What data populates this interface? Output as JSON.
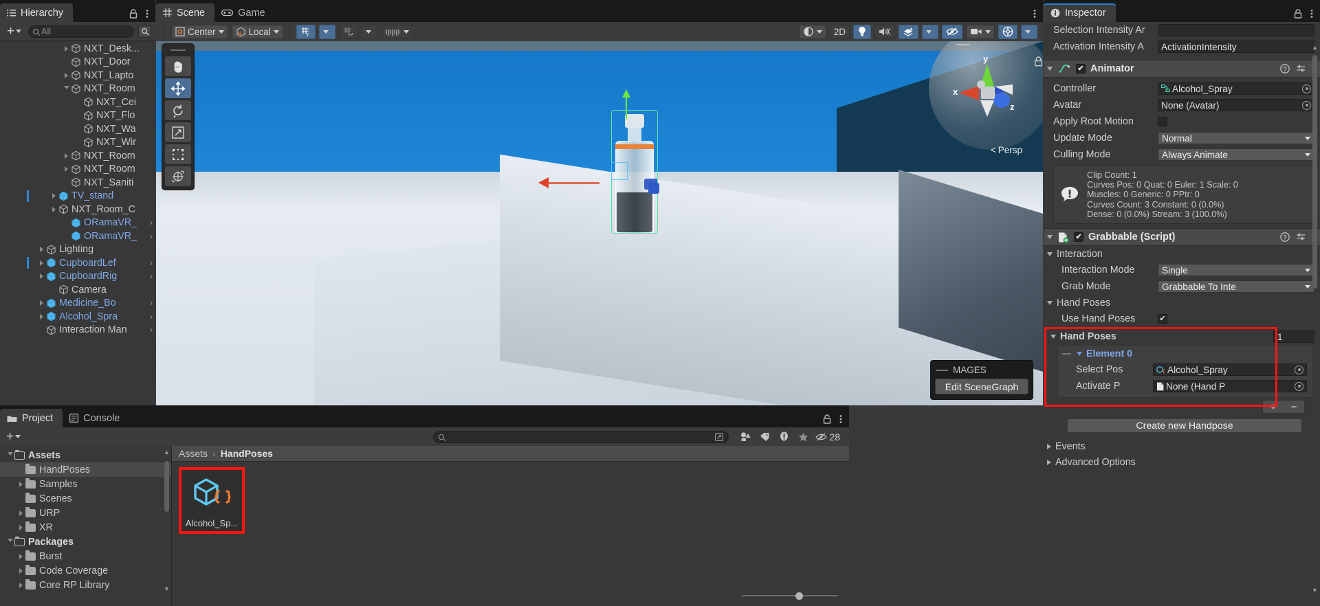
{
  "hierarchy": {
    "tab_label": "Hierarchy",
    "search_placeholder": "All",
    "items": [
      {
        "label": "NXT_Desk...",
        "indent": 4,
        "arrow": "closed",
        "prefab": false,
        "selbar": false
      },
      {
        "label": "NXT_Door",
        "indent": 4,
        "arrow": "none",
        "prefab": false,
        "selbar": false
      },
      {
        "label": "NXT_Lapto",
        "indent": 4,
        "arrow": "closed",
        "prefab": false,
        "selbar": false
      },
      {
        "label": "NXT_Room",
        "indent": 4,
        "arrow": "open",
        "prefab": false,
        "selbar": false
      },
      {
        "label": "NXT_Cei",
        "indent": 5,
        "arrow": "none",
        "prefab": false,
        "selbar": false
      },
      {
        "label": "NXT_Flo",
        "indent": 5,
        "arrow": "none",
        "prefab": false,
        "selbar": false
      },
      {
        "label": "NXT_Wa",
        "indent": 5,
        "arrow": "none",
        "prefab": false,
        "selbar": false
      },
      {
        "label": "NXT_Wir",
        "indent": 5,
        "arrow": "none",
        "prefab": false,
        "selbar": false
      },
      {
        "label": "NXT_Room",
        "indent": 4,
        "arrow": "closed",
        "prefab": false,
        "selbar": false
      },
      {
        "label": "NXT_Room",
        "indent": 4,
        "arrow": "closed",
        "prefab": false,
        "selbar": false
      },
      {
        "label": "NXT_Saniti",
        "indent": 4,
        "arrow": "none",
        "prefab": false,
        "selbar": false
      },
      {
        "label": "TV_stand",
        "indent": 3,
        "arrow": "closed",
        "prefab": true,
        "selbar": true
      },
      {
        "label": "NXT_Room_C",
        "indent": 3,
        "arrow": "closed",
        "prefab": false,
        "selbar": false
      },
      {
        "label": "ORamaVR_",
        "indent": 4,
        "arrow": "none",
        "prefab": true,
        "selbar": false,
        "submenu": true
      },
      {
        "label": "ORamaVR_",
        "indent": 4,
        "arrow": "none",
        "prefab": true,
        "selbar": false,
        "submenu": true
      },
      {
        "label": "Lighting",
        "indent": 2,
        "arrow": "closed",
        "prefab": false,
        "selbar": false
      },
      {
        "label": "CupboardLef",
        "indent": 2,
        "arrow": "closed",
        "prefab": true,
        "selbar": true,
        "submenu": true
      },
      {
        "label": "CupboardRig",
        "indent": 2,
        "arrow": "closed",
        "prefab": true,
        "selbar": false,
        "submenu": true
      },
      {
        "label": "Camera",
        "indent": 3,
        "arrow": "none",
        "prefab": false,
        "selbar": false
      },
      {
        "label": "Medicine_Bo",
        "indent": 2,
        "arrow": "closed",
        "prefab": true,
        "selbar": false,
        "submenu": true
      },
      {
        "label": "Alcohol_Spra",
        "indent": 2,
        "arrow": "closed",
        "prefab": true,
        "selbar": false,
        "submenu": true
      },
      {
        "label": "Interaction Man",
        "indent": 2,
        "arrow": "none",
        "prefab": false,
        "selbar": false,
        "submenu": true
      }
    ]
  },
  "scene": {
    "tabs": [
      {
        "label": "Scene",
        "icon": "grid-icon",
        "active": true
      },
      {
        "label": "Game",
        "icon": "gamepad-icon",
        "active": false
      }
    ],
    "toolbar": {
      "pivot_mode": "Center",
      "handle_space": "Local",
      "grid_snap_icon": "grid-snap-icon",
      "magnet_snap_icon": "magnet-snap-icon",
      "ruler_icon": "ruler-icon",
      "shading_icon": "shading-mode-icon",
      "two_d_label": "2D",
      "light_icon": "lighting-icon",
      "audio_icon": "audio-mute-icon",
      "effects_icon": "effects-icon",
      "hidden_icon": "hidden-objects-icon",
      "camera_icon": "scene-camera-icon",
      "gizmos_icon": "gizmos-icon",
      "options_icon": "kebab-menu-icon"
    },
    "tool_palette": [
      {
        "name": "hand-tool",
        "icon": "✋",
        "active": false
      },
      {
        "name": "move-tool",
        "icon": "move",
        "active": true
      },
      {
        "name": "rotate-tool",
        "icon": "rotate",
        "active": false
      },
      {
        "name": "scale-tool",
        "icon": "scale",
        "active": false
      },
      {
        "name": "rect-tool",
        "icon": "rect",
        "active": false
      },
      {
        "name": "transform-tool",
        "icon": "transform",
        "active": false
      }
    ],
    "gizmo": {
      "x_label": "x",
      "y_label": "y",
      "z_label": "z",
      "perspective_label": "Persp"
    },
    "mages_overlay": {
      "title": "MAGES",
      "button": "Edit SceneGraph"
    }
  },
  "project": {
    "tabs": [
      {
        "label": "Project",
        "icon": "folder-icon",
        "active": true
      },
      {
        "label": "Console",
        "icon": "console-icon",
        "active": false
      }
    ],
    "search_placeholder": "",
    "filter_icons": [
      "asset-type-filter-icon",
      "label-filter-icon",
      "warning-filter-icon",
      "favorites-filter-icon"
    ],
    "hidden_count": "28",
    "tree": [
      {
        "label": "Assets",
        "indent": 0,
        "arrow": "open",
        "bold": true,
        "open_folder": true,
        "selected": false
      },
      {
        "label": "HandPoses",
        "indent": 1,
        "arrow": "none",
        "bold": false,
        "open_folder": false,
        "selected": true
      },
      {
        "label": "Samples",
        "indent": 1,
        "arrow": "closed",
        "bold": false,
        "open_folder": false,
        "selected": false
      },
      {
        "label": "Scenes",
        "indent": 1,
        "arrow": "none",
        "bold": false,
        "open_folder": false,
        "selected": false
      },
      {
        "label": "URP",
        "indent": 1,
        "arrow": "closed",
        "bold": false,
        "open_folder": false,
        "selected": false
      },
      {
        "label": "XR",
        "indent": 1,
        "arrow": "closed",
        "bold": false,
        "open_folder": false,
        "selected": false
      },
      {
        "label": "Packages",
        "indent": 0,
        "arrow": "open",
        "bold": true,
        "open_folder": true,
        "selected": false
      },
      {
        "label": "Burst",
        "indent": 1,
        "arrow": "closed",
        "bold": false,
        "open_folder": false,
        "selected": false
      },
      {
        "label": "Code Coverage",
        "indent": 1,
        "arrow": "closed",
        "bold": false,
        "open_folder": false,
        "selected": false
      },
      {
        "label": "Core RP Library",
        "indent": 1,
        "arrow": "closed",
        "bold": false,
        "open_folder": false,
        "selected": false
      }
    ],
    "breadcrumb": [
      "Assets",
      "HandPoses"
    ],
    "assets": [
      {
        "name": "Alcohol_Sp...",
        "icon": "scriptableobject-icon",
        "selected": true
      }
    ]
  },
  "inspector": {
    "tab_label": "Inspector",
    "top_fields": [
      {
        "label": "Selection Intensity Ar",
        "value": "",
        "type": "text"
      },
      {
        "label": "Activation Intensity A",
        "value": "ActivationIntensity",
        "type": "text"
      }
    ],
    "animator": {
      "title": "Animator",
      "enabled": true,
      "icon": "animator-icon",
      "rows": [
        {
          "label": "Controller",
          "value": "Alcohol_Spray",
          "type": "objref",
          "icon": "controller-icon"
        },
        {
          "label": "Avatar",
          "value": "None (Avatar)",
          "type": "objref",
          "icon": ""
        },
        {
          "label": "Apply Root Motion",
          "value": "",
          "type": "checkbox",
          "checked": false
        },
        {
          "label": "Update Mode",
          "value": "Normal",
          "type": "dropdown"
        },
        {
          "label": "Culling Mode",
          "value": "Always Animate",
          "type": "dropdown"
        }
      ],
      "helpbox": [
        "Clip Count: 1",
        "Curves Pos: 0 Quat: 0 Euler: 1 Scale: 0",
        "Muscles: 0 Generic: 0 PPtr: 0",
        "Curves Count: 3 Constant: 0 (0.0%)",
        "Dense: 0 (0.0%) Stream: 3 (100.0%)"
      ]
    },
    "grabbable": {
      "title": "Grabbable (Script)",
      "enabled": true,
      "icon": "script-icon",
      "groups": [
        {
          "name": "Interaction",
          "rows": [
            {
              "label": "Interaction Mode",
              "value": "Single",
              "type": "dropdown"
            },
            {
              "label": "Grab Mode",
              "value": "Grabbable To Inte",
              "type": "dropdown"
            }
          ]
        },
        {
          "name": "Hand Poses",
          "rows": [
            {
              "label": "Use Hand Poses",
              "value": "",
              "type": "checkbox",
              "checked": true
            }
          ]
        }
      ],
      "hand_poses_array": {
        "label": "Hand Poses",
        "count": "1",
        "element_label": "Element 0",
        "element_rows": [
          {
            "label": "Select Pos",
            "value": "Alcohol_Spray",
            "icon": "scriptableobject-icon"
          },
          {
            "label": "Activate P",
            "value": "None (Hand P",
            "icon": "file-icon"
          }
        ],
        "add_label": "+",
        "remove_label": "−"
      },
      "create_button": "Create new Handpose",
      "footer_foldouts": [
        "Events",
        "Advanced Options"
      ]
    }
  },
  "colors": {
    "accent_blue": "#2c7fd4",
    "prefab_blue": "#7fa9e8",
    "highlight_red": "#ff1414",
    "panel_bg": "#383838",
    "header_bg": "#4a4a4a"
  }
}
